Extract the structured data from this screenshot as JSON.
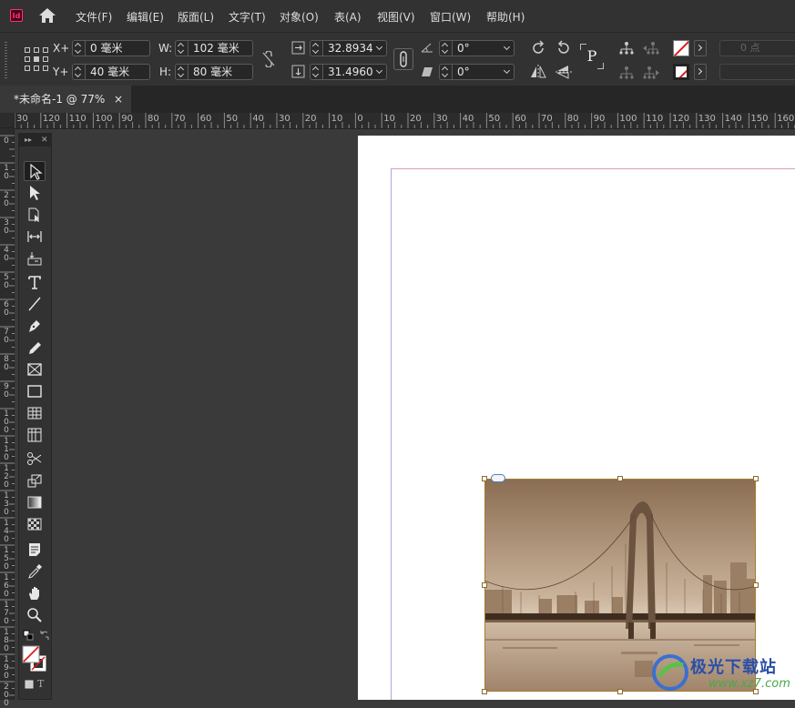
{
  "app": {
    "logo_text": "Id"
  },
  "menu": [
    "文件(F)",
    "编辑(E)",
    "版面(L)",
    "文字(T)",
    "对象(O)",
    "表(A)",
    "视图(V)",
    "窗口(W)",
    "帮助(H)"
  ],
  "control_panel": {
    "x_label": "X+",
    "y_label": "Y+",
    "w_label": "W:",
    "h_label": "H:",
    "x_value": "0 毫米",
    "y_value": "40 毫米",
    "w_value": "102 毫米",
    "h_value": "80 毫米",
    "scale_x": "32.8934",
    "scale_y": "31.4960",
    "rotate": "0°",
    "shear": "0°",
    "stroke_weight": "0 点"
  },
  "document_tab": {
    "title": "*未命名-1 @ 77%",
    "close": "×"
  },
  "ruler": {
    "h_labels": [
      "30",
      "120",
      "110",
      "100",
      "90",
      "80",
      "70",
      "60",
      "50",
      "40",
      "30",
      "20",
      "10",
      "0",
      "10",
      "20",
      "30",
      "40",
      "50",
      "60",
      "70",
      "80",
      "90",
      "100",
      "110",
      "120",
      "130",
      "140",
      "150",
      "160"
    ],
    "v_labels": [
      "0",
      "1 0",
      "2 0",
      "3 0",
      "4 0",
      "5 0",
      "6 0",
      "7 0",
      "8 0",
      "9 0",
      "1 0 0",
      "1 1 0",
      "1 2 0",
      "1 3 0",
      "1 4 0",
      "1 5 0",
      "1 6 0",
      "1 7 0",
      "1 8 0",
      "1 9 0",
      "2 0 0"
    ]
  },
  "watermark": {
    "text": "极光下载站",
    "url": "www.xz7.com"
  },
  "colors": {
    "accent": "#ff3366",
    "frame": "#a67c2c",
    "guide": "#b7a0e8",
    "sepia": "#a88b6a"
  }
}
